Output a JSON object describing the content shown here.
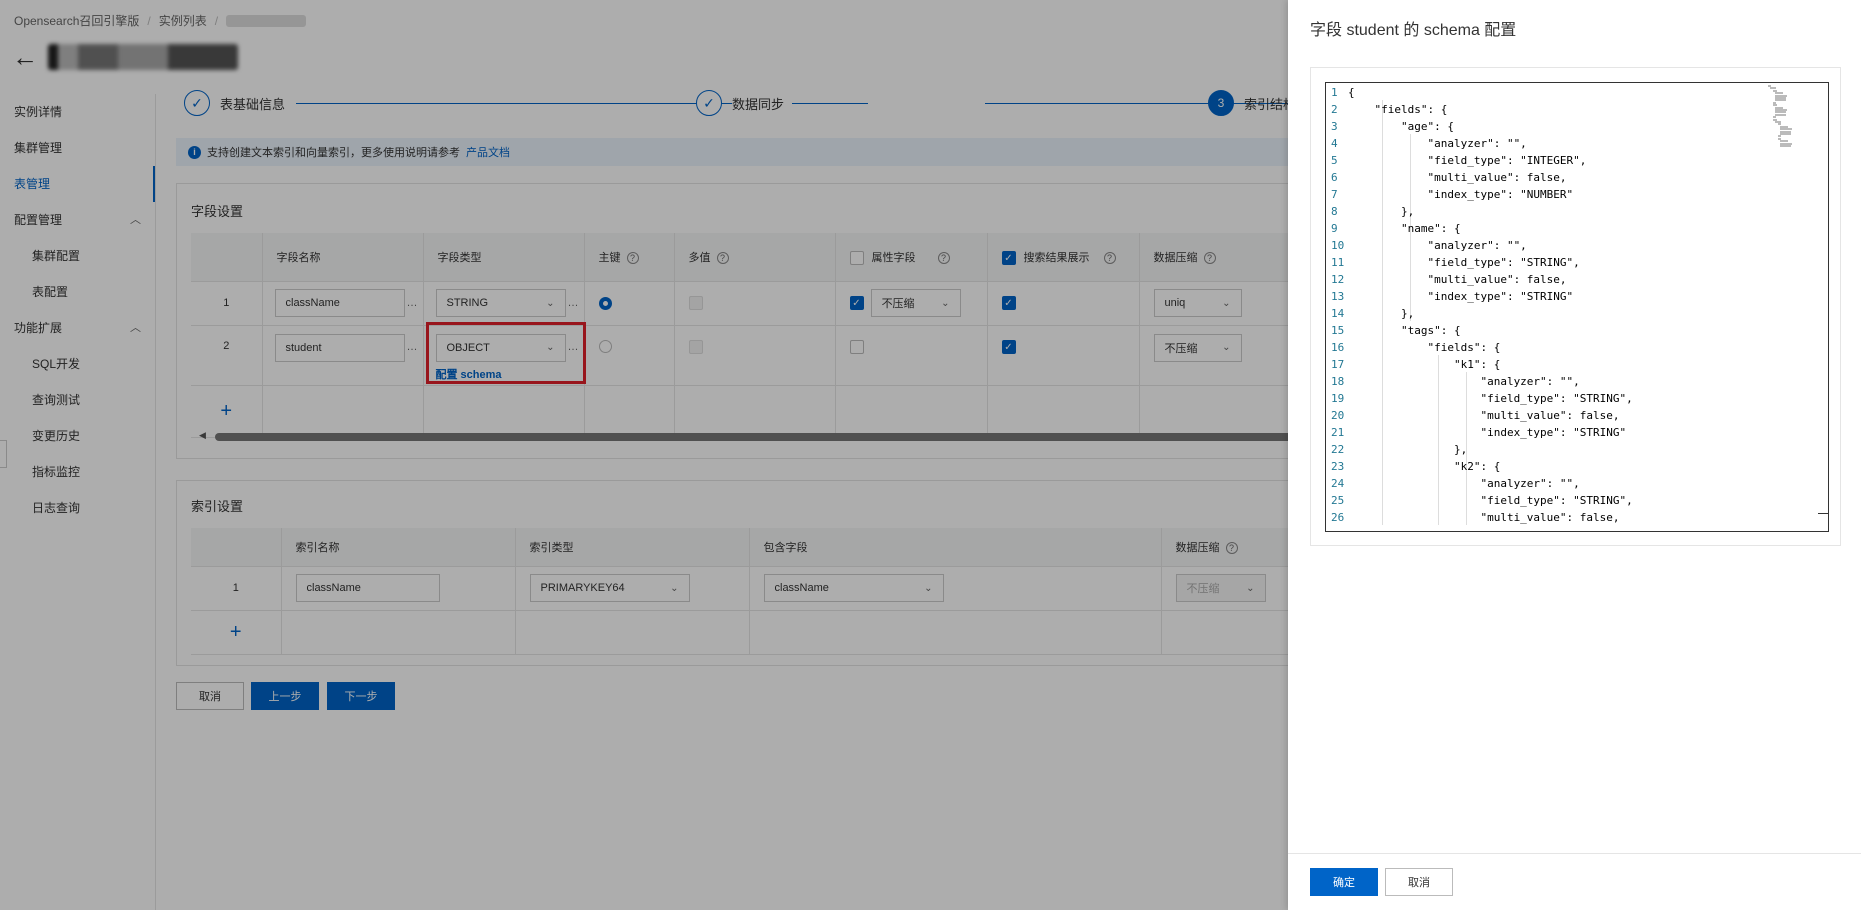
{
  "header": {
    "breadcrumb": [
      "Opensearch召回引擎版",
      "实例列表"
    ],
    "back_icon": "arrow-left-icon"
  },
  "sidebar": {
    "items": [
      {
        "label": "实例详情",
        "level": 0,
        "active": false
      },
      {
        "label": "集群管理",
        "level": 0,
        "active": false
      },
      {
        "label": "表管理",
        "level": 0,
        "active": true
      },
      {
        "label": "配置管理",
        "level": 0,
        "group": true
      },
      {
        "label": "集群配置",
        "level": 1
      },
      {
        "label": "表配置",
        "level": 1
      },
      {
        "label": "功能扩展",
        "level": 0,
        "group": true
      },
      {
        "label": "SQL开发",
        "level": 1
      },
      {
        "label": "查询测试",
        "level": 1
      },
      {
        "label": "变更历史",
        "level": 1
      },
      {
        "label": "指标监控",
        "level": 1
      },
      {
        "label": "日志查询",
        "level": 1
      }
    ]
  },
  "steps": [
    {
      "label": "表基础信息",
      "state": "done",
      "glyph": "✓"
    },
    {
      "label": "数据同步",
      "state": "done",
      "glyph": "✓"
    },
    {
      "label": "索引结构",
      "state": "current",
      "glyph": "3"
    }
  ],
  "info": {
    "text": "支持创建文本索引和向量索引，更多使用说明请参考",
    "link": "产品文档"
  },
  "field_settings": {
    "title": "字段设置",
    "headers": [
      "字段名称",
      "字段类型",
      "主键",
      "多值",
      "属性字段",
      "搜索结果展示",
      "数据压缩"
    ],
    "rows": [
      {
        "index": "1",
        "name": "className",
        "type": "STRING",
        "primary": true,
        "multi": false,
        "attr": true,
        "attr_compress": "不压缩",
        "display": true,
        "compress": "uniq"
      },
      {
        "index": "2",
        "name": "student",
        "type": "OBJECT",
        "primary": false,
        "multi": false,
        "attr": false,
        "display": true,
        "compress": "不压缩",
        "schema_link": "配置 schema"
      }
    ],
    "add_label": "+"
  },
  "index_settings": {
    "title": "索引设置",
    "headers": [
      "索引名称",
      "索引类型",
      "包含字段",
      "数据压缩"
    ],
    "rows": [
      {
        "index": "1",
        "name": "className",
        "type": "PRIMARYKEY64",
        "fields": "className",
        "compress": "不压缩"
      }
    ],
    "add_label": "+"
  },
  "footer": {
    "cancel": "取消",
    "prev": "上一步",
    "next": "下一步"
  },
  "drawer": {
    "title": "字段 student 的 schema 配置",
    "confirm": "确定",
    "cancel": "取消",
    "code_lines": [
      "{",
      "    \"fields\": {",
      "        \"age\": {",
      "            \"analyzer\": \"\",",
      "            \"field_type\": \"INTEGER\",",
      "            \"multi_value\": false,",
      "            \"index_type\": \"NUMBER\"",
      "        },",
      "        \"name\": {",
      "            \"analyzer\": \"\",",
      "            \"field_type\": \"STRING\",",
      "            \"multi_value\": false,",
      "            \"index_type\": \"STRING\"",
      "        },",
      "        \"tags\": {",
      "            \"fields\": {",
      "                \"k1\": {",
      "                    \"analyzer\": \"\",",
      "                    \"field_type\": \"STRING\",",
      "                    \"multi_value\": false,",
      "                    \"index_type\": \"STRING\"",
      "                },",
      "                \"k2\": {",
      "                    \"analyzer\": \"\",",
      "                    \"field_type\": \"STRING\",",
      "                    \"multi_value\": false,"
    ]
  }
}
